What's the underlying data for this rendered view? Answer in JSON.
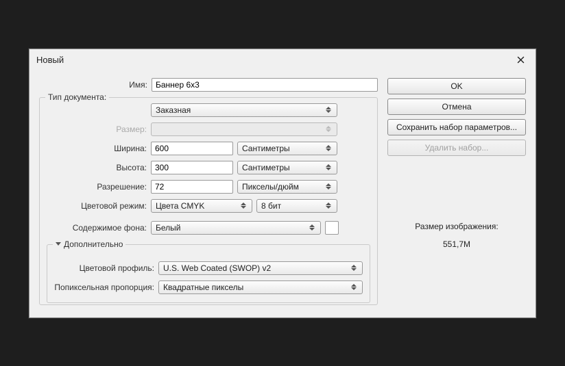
{
  "dialog": {
    "title": "Новый",
    "name_label": "Имя:",
    "name_value": "Баннер 6х3",
    "doc_type_label": "Тип документа:",
    "doc_type_value": "Заказная",
    "size_label": "Размер:",
    "size_value": "",
    "width_label": "Ширина:",
    "width_value": "600",
    "width_unit": "Сантиметры",
    "height_label": "Высота:",
    "height_value": "300",
    "height_unit": "Сантиметры",
    "resolution_label": "Разрешение:",
    "resolution_value": "72",
    "resolution_unit": "Пикселы/дюйм",
    "color_mode_label": "Цветовой режим:",
    "color_mode_value": "Цвета CMYK",
    "color_depth_value": "8 бит",
    "bg_label": "Содержимое фона:",
    "bg_value": "Белый",
    "advanced_label": "Дополнительно",
    "color_profile_label": "Цветовой профиль:",
    "color_profile_value": "U.S. Web Coated (SWOP) v2",
    "pixel_aspect_label": "Попиксельная пропорция:",
    "pixel_aspect_value": "Квадратные пикселы"
  },
  "buttons": {
    "ok": "OK",
    "cancel": "Отмена",
    "save_preset": "Сохранить набор параметров...",
    "delete_preset": "Удалить набор..."
  },
  "image_size": {
    "label": "Размер изображения:",
    "value": "551,7M"
  }
}
